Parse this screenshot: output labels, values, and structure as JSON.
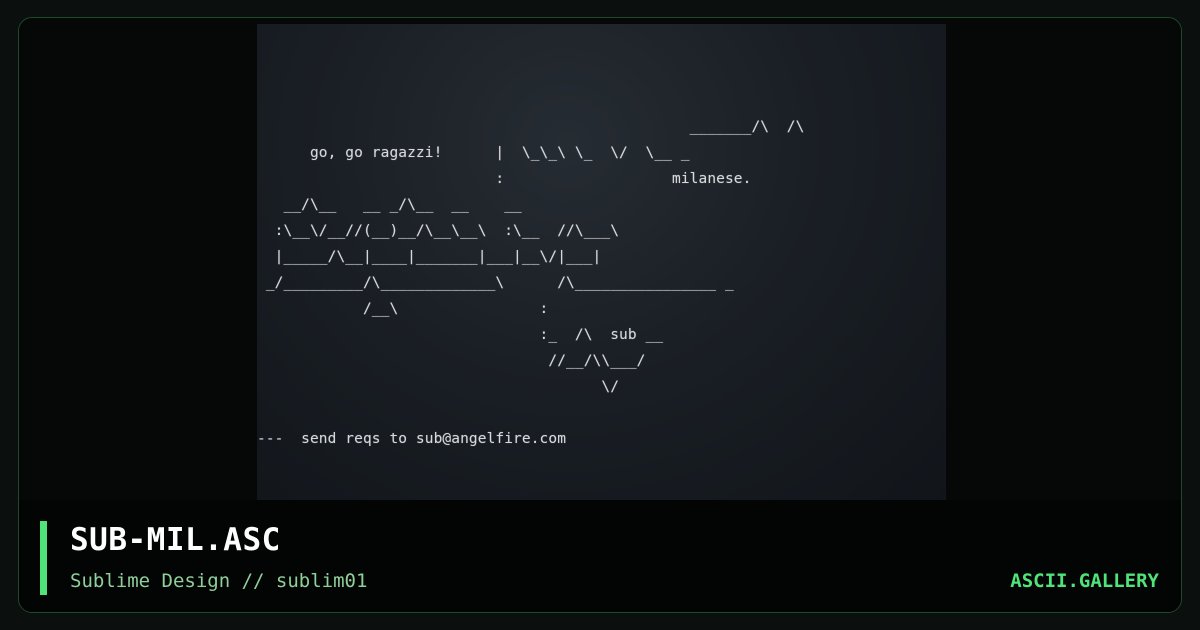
{
  "artwork": {
    "text": "\n                                                 _______/\\  /\\\n      go, go ragazzi!      |  \\_\\_\\ \\_  \\/  \\__ _\n                           :                   milanese.\n   __/\\__   __ _/\\__  __    __\n  :\\__\\/__//(__)__/\\__\\__\\  :\\__  //\\___\\\n  |_____/\\__|____|_______|___|__\\/|___|\n _/_________/\\_____________\\      /\\________________ _\n            /__\\                :\n                                :_  /\\  sub __\n                                 //__/\\\\___/\n                                       \\/\n\n---  send reqs to sub@angelfire.com"
  },
  "footer": {
    "title": "SUB-MIL.ASC",
    "subtitle": "Sublime Design // sublim01",
    "brand": "ASCII.GALLERY"
  },
  "colors": {
    "accent": "#4fe37a",
    "subtitle": "#8fcf9b",
    "card_border": "#1f4a2a",
    "art_background": "#1a1f25"
  }
}
